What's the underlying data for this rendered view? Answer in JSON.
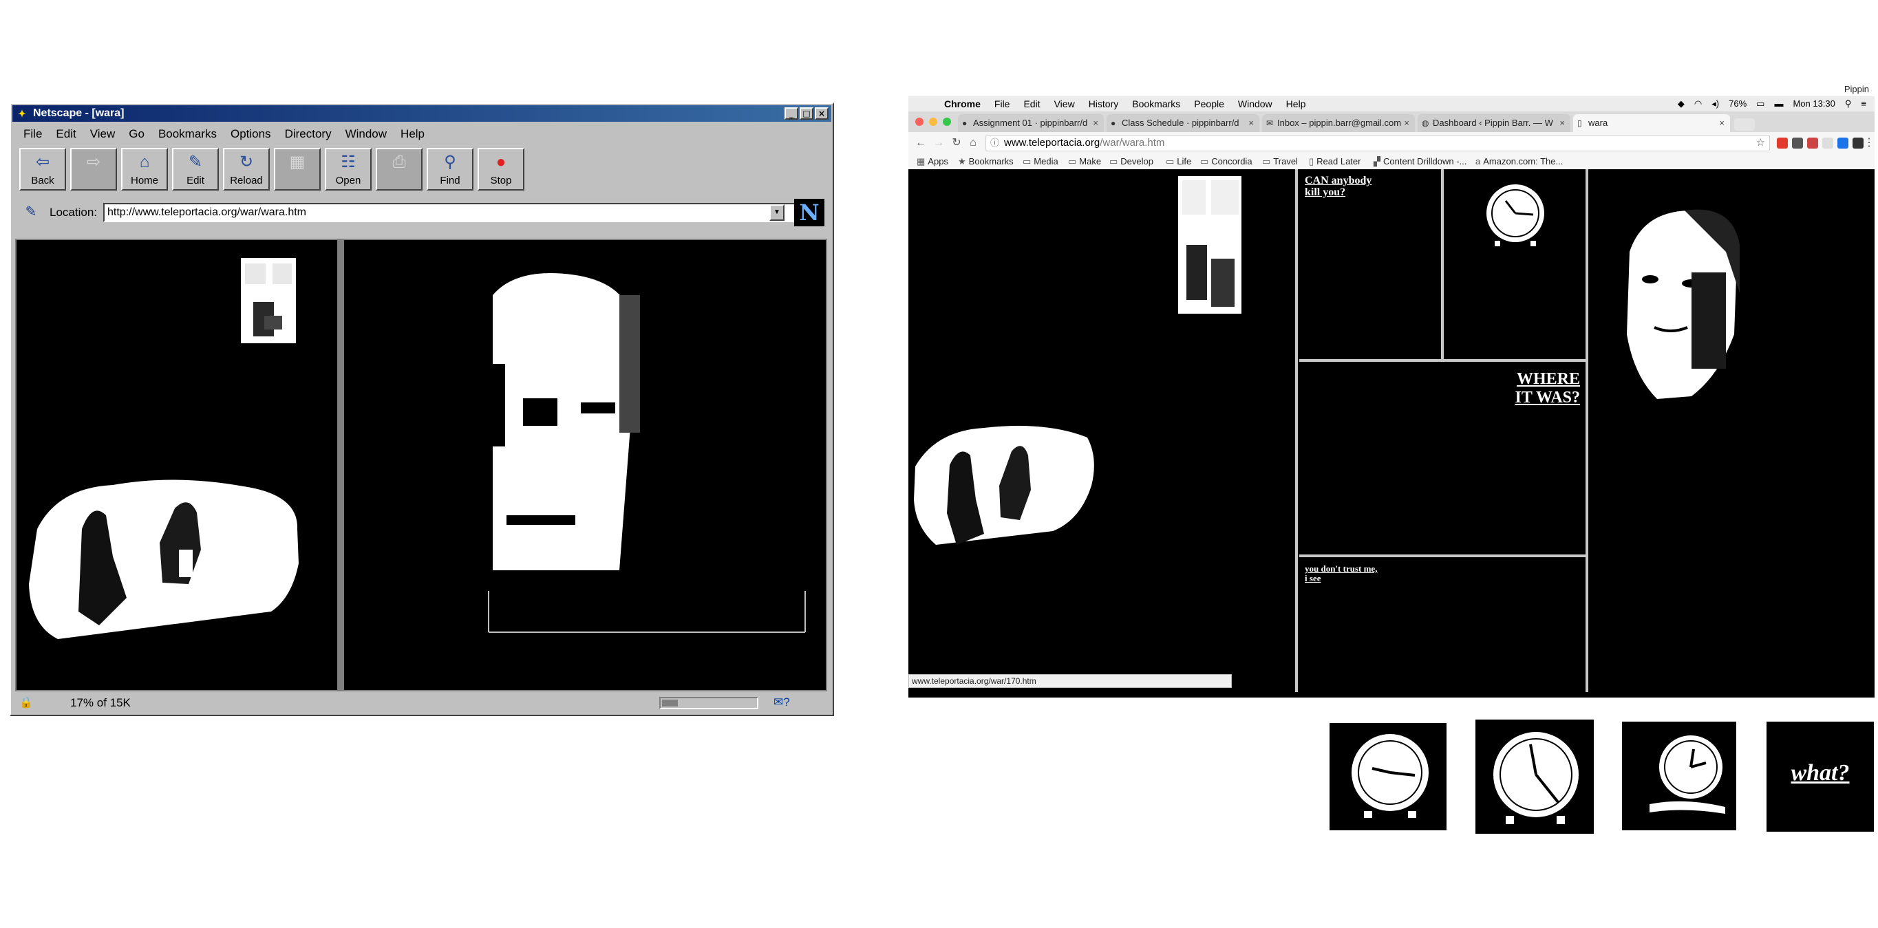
{
  "netscape": {
    "title": "Netscape - [wara]",
    "window_buttons": [
      "_",
      "□",
      "×"
    ],
    "menus": [
      "File",
      "Edit",
      "View",
      "Go",
      "Bookmarks",
      "Options",
      "Directory",
      "Window",
      "Help"
    ],
    "toolbar": [
      {
        "label": "Back",
        "icon": "back-arrow-icon",
        "glyph": "⇦",
        "enabled": true
      },
      {
        "label": "",
        "icon": "forward-arrow-icon",
        "glyph": "⇨",
        "enabled": false
      },
      {
        "label": "Home",
        "icon": "home-icon",
        "glyph": "⌂",
        "enabled": true
      },
      {
        "label": "Edit",
        "icon": "pencil-icon",
        "glyph": "✎",
        "enabled": true
      },
      {
        "label": "Reload",
        "icon": "reload-icon",
        "glyph": "↻",
        "enabled": true
      },
      {
        "label": "",
        "icon": "images-icon",
        "glyph": "▦",
        "enabled": false
      },
      {
        "label": "Open",
        "icon": "open-icon",
        "glyph": "☷",
        "enabled": true
      },
      {
        "label": "",
        "icon": "print-icon",
        "glyph": "⎙",
        "enabled": false
      },
      {
        "label": "Find",
        "icon": "binoculars-icon",
        "glyph": "⚲",
        "enabled": true
      },
      {
        "label": "Stop",
        "icon": "stop-icon",
        "glyph": "●",
        "enabled": true
      }
    ],
    "location_label": "Location:",
    "location_url": "http://www.teleportacia.org/war/wara.htm",
    "logo_letter": "N",
    "status_text": "17% of 15K",
    "progress": 0.17
  },
  "chrome": {
    "mac_menu": {
      "app": "Chrome",
      "items": [
        "File",
        "Edit",
        "View",
        "History",
        "Bookmarks",
        "People",
        "Window",
        "Help"
      ]
    },
    "mac_status": {
      "battery": "76%",
      "clock": "Mon 13:30"
    },
    "tabs": [
      {
        "title": "Assignment 01 · pippinbarr/d",
        "icon": "github-icon",
        "active": false
      },
      {
        "title": "Class Schedule · pippinbarr/d",
        "icon": "github-icon",
        "active": false
      },
      {
        "title": "Inbox – pippin.barr@gmail.com",
        "icon": "mail-icon",
        "active": false
      },
      {
        "title": "Dashboard ‹ Pippin Barr. — W",
        "icon": "wordpress-icon",
        "active": false
      },
      {
        "title": "wara",
        "icon": "page-icon",
        "active": true
      }
    ],
    "profile": "Pippin",
    "url_host": "www.teleportacia.org",
    "url_path": "/war/wara.htm",
    "bookmarks": [
      "Apps",
      "Bookmarks",
      "Media",
      "Make",
      "Develop",
      "Life",
      "Concordia",
      "Travel",
      "Read Later",
      "Content Drilldown -...",
      "Amazon.com: The..."
    ],
    "links": {
      "kill": [
        "CAN anybody",
        "kill you?"
      ],
      "where": [
        "WHERE",
        "IT WAS?"
      ],
      "trust": [
        "you don't trust me,",
        "i see"
      ]
    },
    "status_url": "www.teleportacia.org/war/170.htm"
  },
  "thumbnails": {
    "what_label": "what?"
  },
  "colors": {
    "netscape_title": "#0a246a",
    "win_gray": "#c0c0c0",
    "black": "#000000",
    "white": "#ffffff",
    "divider": "#c8c8c8"
  }
}
